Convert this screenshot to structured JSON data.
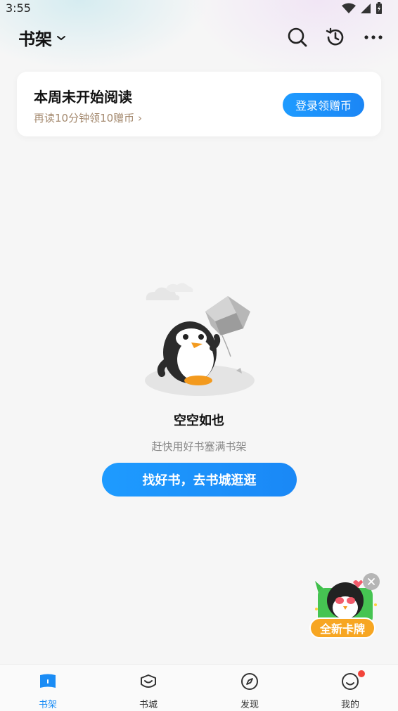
{
  "status_bar": {
    "time": "3:55"
  },
  "header": {
    "title": "书架"
  },
  "reading_card": {
    "title": "本周未开始阅读",
    "subtitle": "再读10分钟领10赠币 ›",
    "login_button": "登录领赠币"
  },
  "empty_state": {
    "title": "空空如也",
    "subtitle": "赶快用好书塞满书架",
    "button": "找好书，去书城逛逛"
  },
  "promo": {
    "label": "全新卡牌"
  },
  "bottom_nav": {
    "items": [
      {
        "label": "书架",
        "icon": "bookshelf-icon",
        "active": true
      },
      {
        "label": "书城",
        "icon": "bookstore-icon",
        "active": false
      },
      {
        "label": "发现",
        "icon": "compass-icon",
        "active": false
      },
      {
        "label": "我的",
        "icon": "profile-icon",
        "active": false,
        "badge": true
      }
    ]
  },
  "colors": {
    "accent": "#1a8cf5",
    "badge": "#f2443a",
    "promo": "#f7a622",
    "subtitle": "#a4896e"
  }
}
